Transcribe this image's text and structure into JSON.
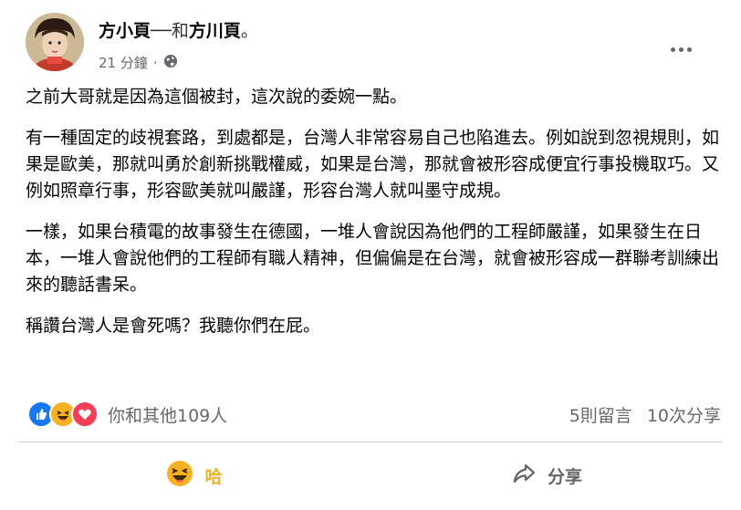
{
  "post": {
    "author": "方小頁",
    "separator": "──和",
    "tagged": "方川頁",
    "end_mark": "。",
    "time": "21 分鐘",
    "dot": "·",
    "privacy_icon": "globe-icon",
    "paragraphs": [
      "之前大哥就是因為這個被封，這次說的委婉一點。",
      "有一種固定的歧視套路，到處都是，台灣人非常容易自己也陷進去。例如說到忽視規則，如果是歐美，那就叫勇於創新挑戰權威，如果是台灣，那就會被形容成便宜行事投機取巧。又例如照章行事，形容歐美就叫嚴謹，形容台灣人就叫墨守成規。",
      "一樣，如果台積電的故事發生在德國，一堆人會說因為他們的工程師嚴謹，如果發生在日本，一堆人會說他們的工程師有職人精神，但偏偏是在台灣，就會被形容成一群聯考訓練出來的聽話書呆。",
      "稱讚台灣人是會死嗎？我聽你們在屁。"
    ]
  },
  "reactions": {
    "icons": [
      "like-icon",
      "haha-icon",
      "love-icon"
    ],
    "summary": "你和其他109人",
    "comments": "5則留言",
    "shares": "10次分享"
  },
  "actions": {
    "react_label": "哈",
    "share_label": "分享"
  },
  "colors": {
    "like": "#1877f2",
    "haha": "#f7b125",
    "love": "#f33e58",
    "secondary_text": "#65676b",
    "active_reaction": "#eab026"
  }
}
